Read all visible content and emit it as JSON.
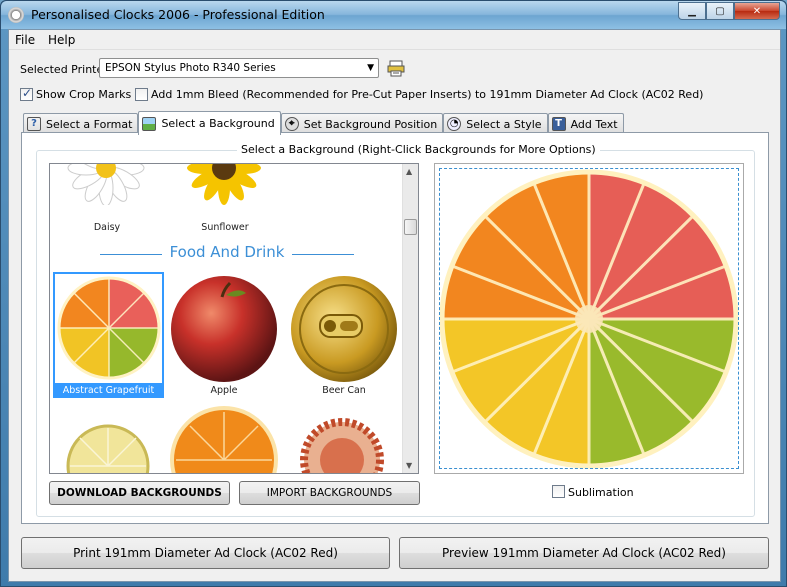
{
  "window": {
    "title": "Personalised Clocks 2006 - Professional Edition"
  },
  "menu": [
    "File",
    "Help"
  ],
  "printer": {
    "label": "Selected Printer",
    "value": "EPSON Stylus Photo R340 Series"
  },
  "options": {
    "crop_marks": {
      "label": "Show Crop Marks",
      "checked": true
    },
    "bleed": {
      "label": "Add 1mm Bleed (Recommended for Pre-Cut Paper Inserts) to 191mm Diameter Ad Clock (AC02 Red)",
      "checked": false
    }
  },
  "tabs": [
    {
      "label": "Select a Format",
      "icon": "help-icon"
    },
    {
      "label": "Select a Background",
      "icon": "image-icon",
      "active": true
    },
    {
      "label": "Set Background Position",
      "icon": "position-icon"
    },
    {
      "label": "Select a Style",
      "icon": "style-icon"
    },
    {
      "label": "Add Text",
      "icon": "text-icon"
    }
  ],
  "group_title": "Select a Background (Right-Click Backgrounds for More Options)",
  "gallery": {
    "flowers": [
      "Daisy",
      "Sunflower"
    ],
    "category": "Food And Drink",
    "food": [
      "Abstract Grapefruit",
      "Apple",
      "Beer Can"
    ],
    "selected": "Abstract Grapefruit"
  },
  "buttons": {
    "download": "DOWNLOAD BACKGROUNDS",
    "import": "IMPORT BACKGROUNDS",
    "print": "Print 191mm Diameter Ad Clock (AC02 Red)",
    "preview": "Preview 191mm Diameter Ad Clock (AC02 Red)"
  },
  "sublimation": {
    "label": "Sublimation",
    "checked": false
  },
  "colors": {
    "accent": "#3399ff",
    "category": "#3c8fd6"
  }
}
